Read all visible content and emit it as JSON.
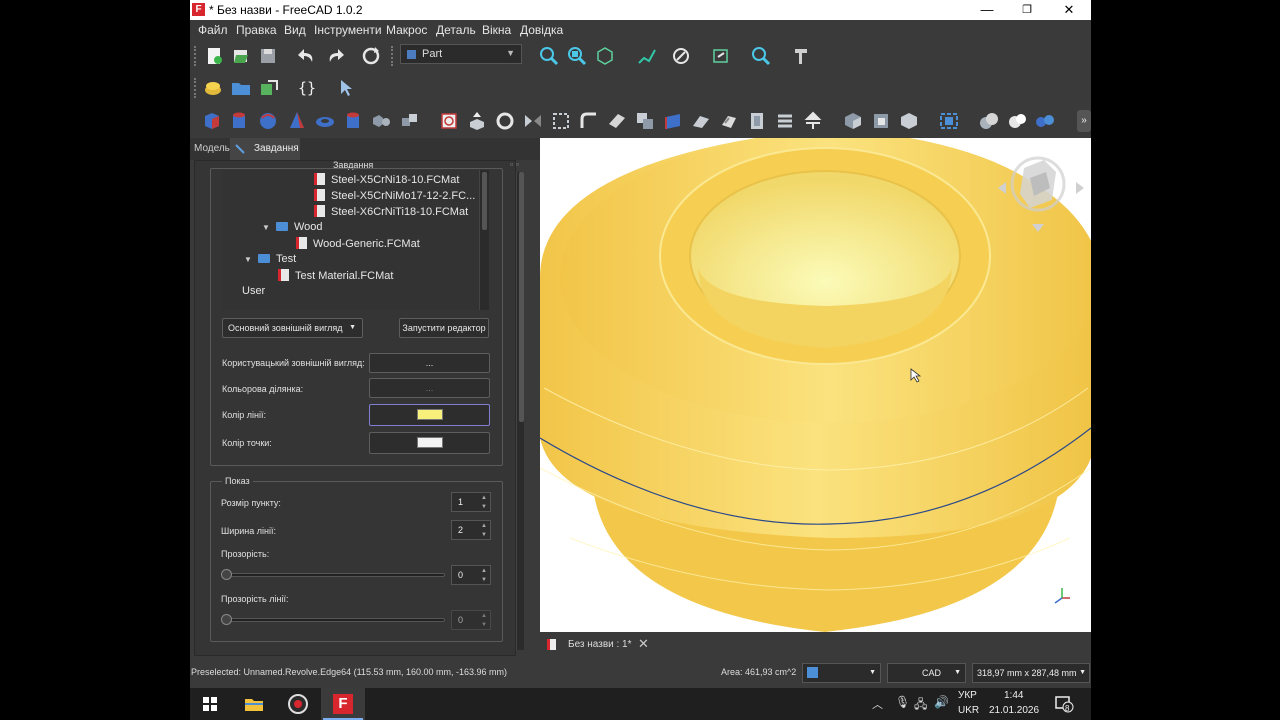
{
  "window": {
    "title": "* Без назви - FreeCAD 1.0.2",
    "min_glyph": "—",
    "max_glyph": "❐",
    "close_glyph": "✕"
  },
  "menu": [
    "Файл",
    "Правка",
    "Вид",
    "Інструменти",
    "Макрос",
    "Деталь",
    "Вікна",
    "Довідка"
  ],
  "workbench": "Part",
  "panel_tabs": [
    "Модель",
    "Завдання"
  ],
  "panel": {
    "section_title": "Завдання",
    "tree": [
      {
        "label": "Steel-X5CrNi18-10.FCMat",
        "kind": "file"
      },
      {
        "label": "Steel-X5CrNiMo17-12-2.FC...",
        "kind": "file"
      },
      {
        "label": "Steel-X6CrNiTi18-10.FCMat",
        "kind": "file"
      },
      {
        "label": "Wood",
        "kind": "folder"
      },
      {
        "label": "Wood-Generic.FCMat",
        "kind": "file"
      },
      {
        "label": "Test",
        "kind": "folder"
      },
      {
        "label": "Test Material.FCMat",
        "kind": "file"
      },
      {
        "label": "User",
        "kind": "plain"
      }
    ],
    "appearance_combo": "Основний зовнішній вигляд",
    "launch_editor": "Запустити редактор",
    "custom_appearance_label": "Користувацький зовнішній вигляд:",
    "custom_appearance_btn": "...",
    "color_plot_label": "Кольорова ділянка:",
    "color_plot_btn": "...",
    "line_color_label": "Колір лінії:",
    "line_color": "#f7f07a",
    "point_color_label": "Колір точки:",
    "point_color": "#f2f2f2",
    "display_group": "Показ",
    "point_size_label": "Розмір пункту:",
    "point_size": "1",
    "line_width_label": "Ширина лінії:",
    "line_width": "2",
    "transparency_label": "Прозорість:",
    "transparency": "0",
    "line_transparency_label": "Прозорість лінії:",
    "line_transparency": "0"
  },
  "doc_tab": "Без назви : 1*",
  "status": {
    "preselected": "Preselected: Unnamed.Revolve.Edge64 (115.53 mm, 160.00 mm, -163.96 mm)",
    "area": "Area: 461,93 cm^2",
    "nav_style": "CAD",
    "dimensions": "318,97 mm x 287,48 mm"
  },
  "taskbar": {
    "lang_top": "УКР",
    "lang_bottom": "UKR",
    "time": "1:44",
    "date": "21.01.2026",
    "notif_count": "8"
  },
  "colors": {
    "accent_red": "#d8262e",
    "model_yellow": "#f6cf52",
    "edge_blue": "#2b4a8a"
  }
}
